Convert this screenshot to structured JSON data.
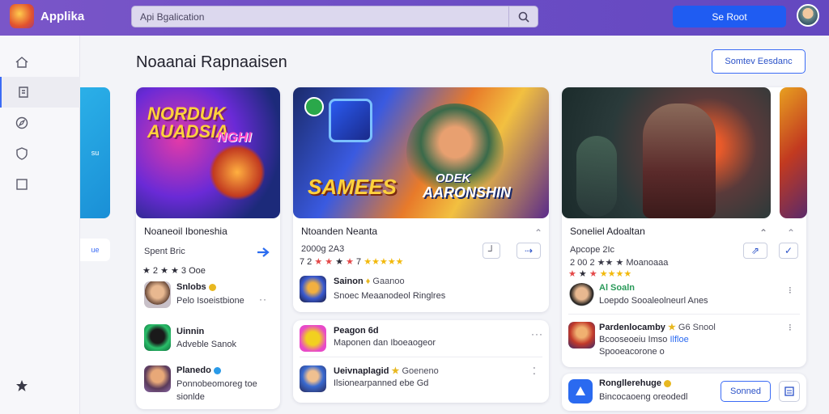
{
  "topbar": {
    "app_name": "Applika",
    "search_text": "Api Bgalication",
    "action_button": "Se Root"
  },
  "sidebar": {
    "items": [
      {
        "icon": "home-icon"
      },
      {
        "icon": "store-icon"
      },
      {
        "icon": "compass-icon"
      },
      {
        "icon": "shield-icon"
      },
      {
        "icon": "square-icon"
      },
      {
        "icon": "star-icon"
      }
    ]
  },
  "page": {
    "title": "Noaanai Rapnaaisen",
    "header_button": "Somtev Eesdanc"
  },
  "partial_left": {
    "top_text": "su",
    "bottom_text": "ue"
  },
  "cards": [
    {
      "hero_text": "NORDUK AUADSIA",
      "hero_text_2": "NGHI",
      "title": "Noaneoil Iboneshia",
      "subtitle": "Spent Bric",
      "rating_text": "★ 2 ★ ★ 3 Ooe",
      "rows": [
        {
          "title": "Snlobs",
          "sub": "Pelo Isoeistbione"
        },
        {
          "title": "Uinnin",
          "sub": "Adveble Sanok"
        },
        {
          "title": "Planedo",
          "sub": "Ponnobeomoreg toe",
          "sub2": "sionlde"
        }
      ]
    },
    {
      "hero_text": "SAMEES",
      "hero_text_2": "ODEK",
      "hero_text_3": "AARONSHIN",
      "title": "Ntoanden Neanta",
      "subtitle": "2000g 2A3",
      "rating_prefix": "7 2",
      "rows": [
        {
          "title": "Sainon",
          "meta": "Gaanoo",
          "sub": "Snoec Meaanodeol Ringlres"
        },
        {
          "title": "Peagon 6d",
          "sub": "Maponen dan Iboeaogeor"
        },
        {
          "title": "Ueivnaplagid",
          "meta": "Goeneno",
          "sub": "Ilsionearpanned ebe Gd"
        }
      ]
    },
    {
      "title": "Soneliel Adoaltan",
      "subtitle": "Apcope 2Ic",
      "rating_prefix": "2 00 2",
      "rating_suffix": "Moanoaaa",
      "rows": [
        {
          "title": "Al Soaln",
          "sub": "Loepdo Sooaleolneurl Anes"
        },
        {
          "title": "Pardenlocamby",
          "meta": "G6 Snool",
          "sub": "Bcooseoeiu Imso",
          "sub2": "Ilfloe",
          "sub3": "Spooeacorone",
          "sub4": "o"
        },
        {
          "title": "Rongllerehuge",
          "sub": "Bincocaoeng oreodedl",
          "button": "Sonned"
        }
      ]
    }
  ]
}
